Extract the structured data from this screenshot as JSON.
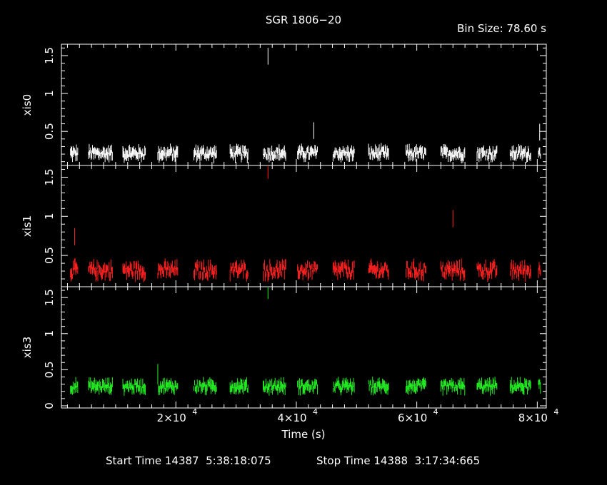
{
  "chart_data": {
    "type": "scatter",
    "title": "SGR 1806−20",
    "bin_size_label": "Bin Size: 78.60 s",
    "xlabel": "Time (s)",
    "x_tick_labels": [
      "2×10",
      "4×10",
      "6×10",
      "8×10"
    ],
    "x_tick_exponent": "4",
    "xlim": [
      1000,
      81500
    ],
    "footer": {
      "start_label": "Start Time 14387  5:38:18:075",
      "stop_label": "Stop Time 14388  3:17:34:665"
    },
    "panels": [
      {
        "ylabel": "xis0",
        "color": "#ffffff",
        "ylim": [
          0.05,
          1.65
        ],
        "tick_values": [
          0.5,
          1,
          1.5
        ],
        "tick_labels": [
          "0.5",
          "1",
          "1.5"
        ],
        "base_rate": 0.21,
        "spread": 0.06,
        "spikes": [
          {
            "x": 35300,
            "y": 1.5
          },
          {
            "x": 42900,
            "y": 0.52
          },
          {
            "x": 80400,
            "y": 0.5
          }
        ]
      },
      {
        "ylabel": "xis1",
        "color": "#ff2020",
        "ylim": [
          0.1,
          1.65
        ],
        "tick_values": [
          0.5,
          1,
          1.5
        ],
        "tick_labels": [
          "0.5",
          "1",
          "1.5"
        ],
        "base_rate": 0.31,
        "spread": 0.08,
        "spikes": [
          {
            "x": 3200,
            "y": 0.75
          },
          {
            "x": 35300,
            "y": 1.6
          },
          {
            "x": 66000,
            "y": 0.98
          }
        ]
      },
      {
        "ylabel": "xis3",
        "color": "#22ee22",
        "ylim": [
          -0.03,
          1.65
        ],
        "tick_values": [
          0,
          0.5,
          1,
          1.5
        ],
        "tick_labels": [
          "0",
          "0.5",
          "1",
          "1.5"
        ],
        "base_rate": 0.27,
        "spread": 0.06,
        "spikes": [
          {
            "x": 35300,
            "y": 1.6
          },
          {
            "x": 17000,
            "y": 0.48
          }
        ]
      }
    ],
    "segments": [
      [
        2500,
        3800
      ],
      [
        5500,
        9500
      ],
      [
        11200,
        15000
      ],
      [
        17000,
        20300
      ],
      [
        23000,
        26800
      ],
      [
        29000,
        32000
      ],
      [
        34500,
        38300
      ],
      [
        40200,
        43500
      ],
      [
        46100,
        49700
      ],
      [
        52000,
        55300
      ],
      [
        58200,
        61500
      ],
      [
        64000,
        68000
      ],
      [
        70000,
        73300
      ],
      [
        75500,
        79000
      ],
      [
        80200,
        80600
      ]
    ]
  }
}
